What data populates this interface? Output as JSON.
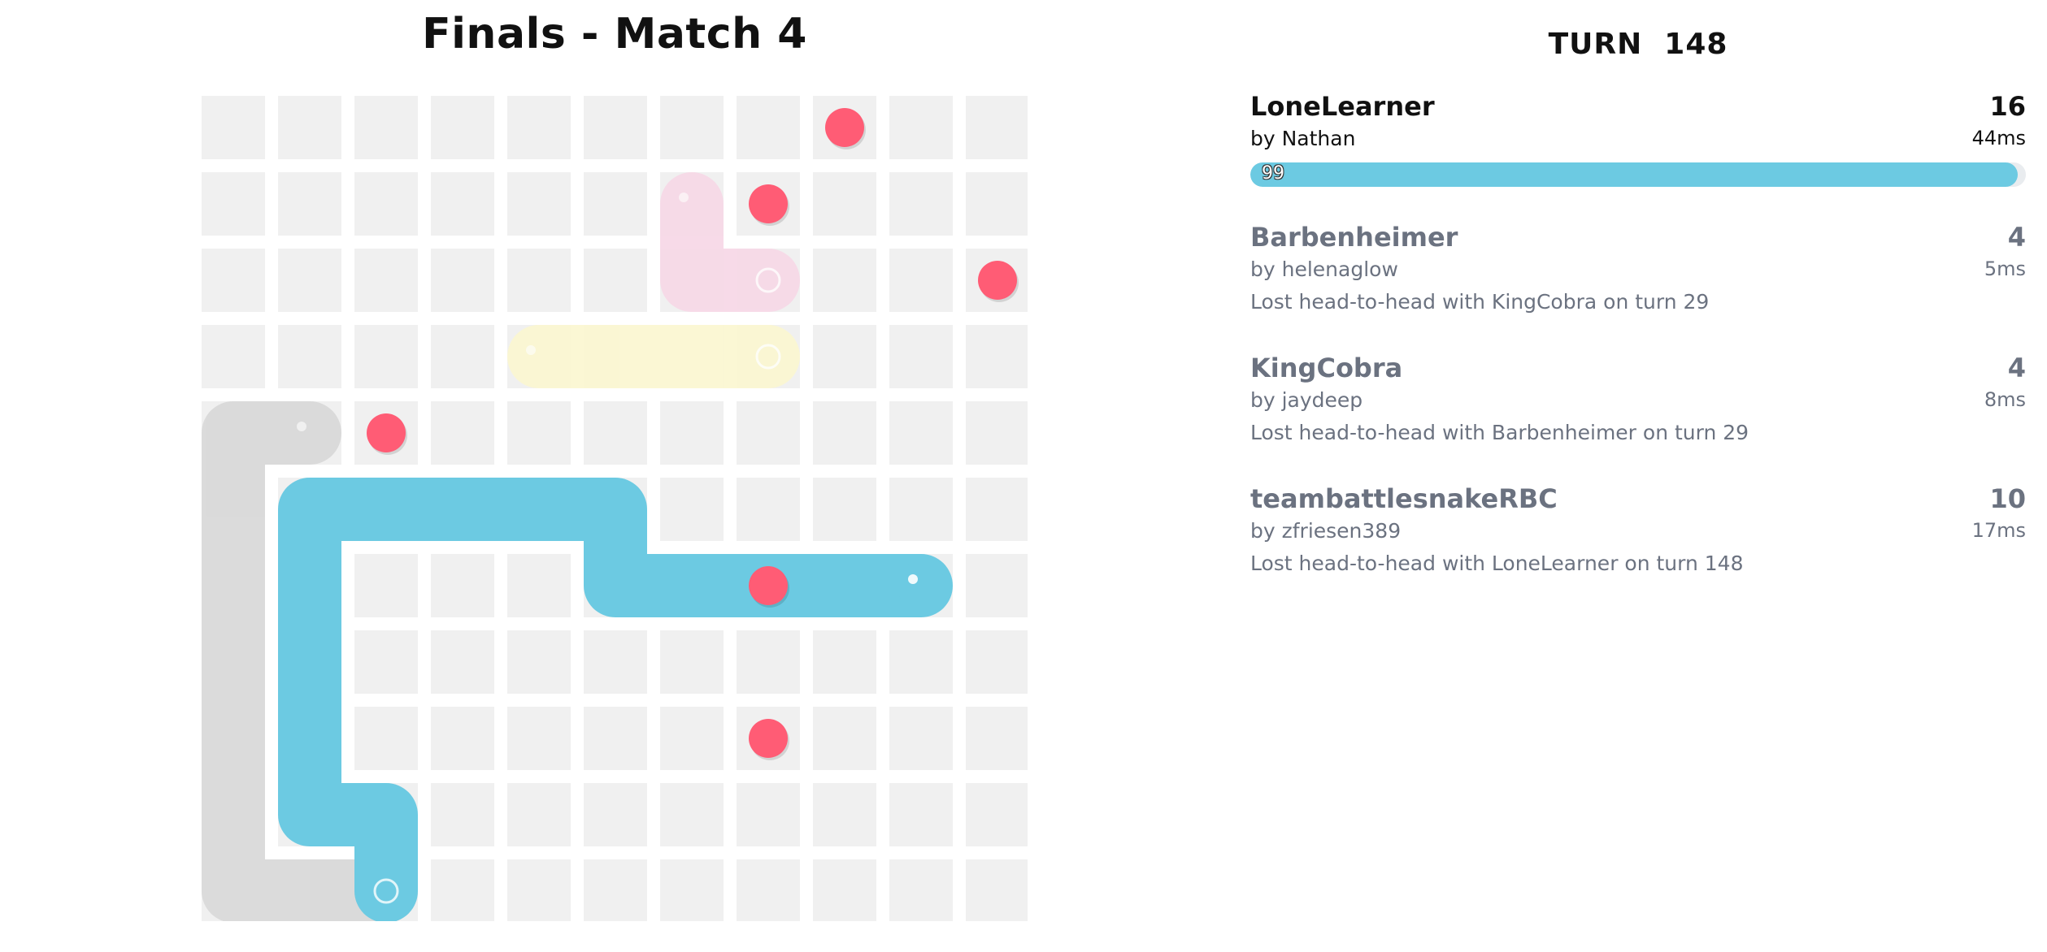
{
  "match": {
    "title": "Finals - Match 4"
  },
  "turn": {
    "label": "TURN",
    "value": "148"
  },
  "board": {
    "width": 11,
    "height": 11,
    "food": [
      [
        8,
        10
      ],
      [
        7,
        9
      ],
      [
        10,
        8
      ],
      [
        2,
        6
      ],
      [
        7,
        4
      ],
      [
        7,
        2
      ]
    ],
    "snakes": [
      {
        "id": "lonelearner",
        "color": "#6ccae2",
        "alive": true,
        "body": [
          [
            9,
            4
          ],
          [
            8,
            4
          ],
          [
            7,
            4
          ],
          [
            6,
            4
          ],
          [
            5,
            4
          ],
          [
            5,
            5
          ],
          [
            4,
            5
          ],
          [
            3,
            5
          ],
          [
            2,
            5
          ],
          [
            1,
            5
          ],
          [
            1,
            4
          ],
          [
            1,
            3
          ],
          [
            1,
            2
          ],
          [
            1,
            1
          ],
          [
            2,
            1
          ],
          [
            2,
            0
          ]
        ],
        "head_icon": "snake-head-icon",
        "tail_icon": "snake-tail-icon"
      },
      {
        "id": "barbenheimer",
        "color": "#f7d9e7",
        "alive": false,
        "body": [
          [
            6,
            9
          ],
          [
            6,
            8
          ],
          [
            7,
            8
          ]
        ],
        "head_icon": "snake-head-icon",
        "tail_icon": "snake-tail-icon"
      },
      {
        "id": "kingcobra",
        "color": "#fbf7d2",
        "alive": false,
        "body": [
          [
            4,
            7
          ],
          [
            5,
            7
          ],
          [
            6,
            7
          ],
          [
            7,
            7
          ]
        ],
        "head_icon": "snake-head-icon",
        "tail_icon": "snake-tail-icon"
      },
      {
        "id": "teambattlesnakerbc",
        "color": "#d9d9d9",
        "alive": false,
        "body": [
          [
            1,
            6
          ],
          [
            0,
            6
          ],
          [
            0,
            5
          ],
          [
            0,
            4
          ],
          [
            0,
            3
          ],
          [
            0,
            2
          ],
          [
            0,
            1
          ],
          [
            0,
            0
          ],
          [
            1,
            0
          ],
          [
            2,
            0
          ]
        ],
        "head_icon": "snake-head-icon",
        "tail_icon": "snake-tail-icon"
      }
    ],
    "colors": {
      "cell": "#f0f0f0",
      "food": "#ff5c75"
    }
  },
  "scoreboard": [
    {
      "name": "LoneLearner",
      "author": "by Nathan",
      "length": "16",
      "latency": "44ms",
      "health": "99",
      "health_fraction": 0.99,
      "color": "#6ccae2",
      "alive": true,
      "death": ""
    },
    {
      "name": "Barbenheimer",
      "author": "by helenaglow",
      "length": "4",
      "latency": "5ms",
      "alive": false,
      "death": "Lost head-to-head with KingCobra on turn 29"
    },
    {
      "name": "KingCobra",
      "author": "by jaydeep",
      "length": "4",
      "latency": "8ms",
      "alive": false,
      "death": "Lost head-to-head with Barbenheimer on turn 29"
    },
    {
      "name": "teambattlesnakeRBC",
      "author": "by zfriesen389",
      "length": "10",
      "latency": "17ms",
      "alive": false,
      "death": "Lost head-to-head with LoneLearner on turn 148"
    }
  ]
}
